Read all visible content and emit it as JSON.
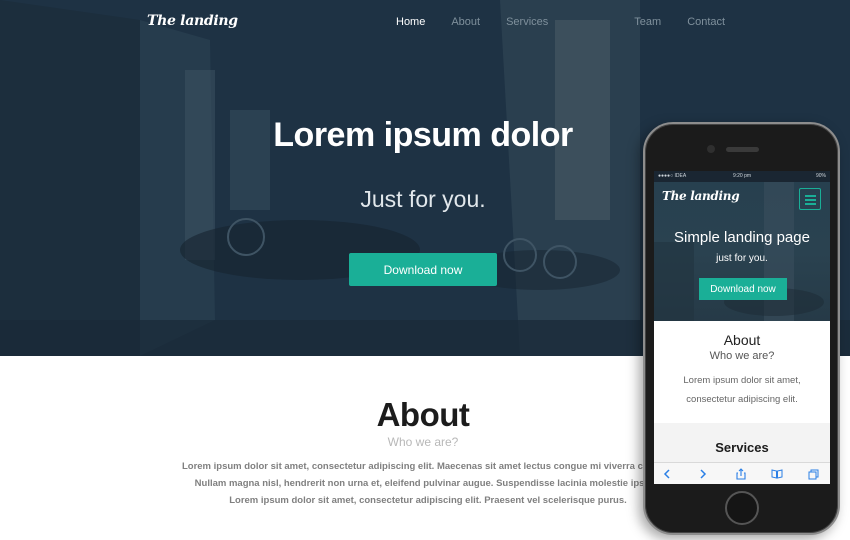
{
  "nav": {
    "logo": "The landing",
    "links": [
      "Home",
      "About",
      "Services",
      "Team",
      "Contact"
    ],
    "active": "Home"
  },
  "hero": {
    "title": "Lorem ipsum dolor",
    "subtitle": "Just for you.",
    "button": "Download now"
  },
  "about": {
    "title": "About",
    "subtitle": "Who we are?",
    "lines": [
      "Lorem ipsum dolor sit amet, consectetur adipiscing elit. Maecenas sit amet lectus congue mi viverra congue.",
      "Nullam magna nisl, hendrerit non urna et, eleifend pulvinar augue. Suspendisse lacinia molestie ipsum.",
      "Lorem ipsum dolor sit amet, consectetur adipiscing elit. Praesent vel scelerisque purus."
    ]
  },
  "mobile": {
    "status": {
      "carrier": "●●●●○ IDEA",
      "time": "9:20 pm",
      "battery": "90%"
    },
    "logo": "The landing",
    "hero_title": "Simple landing page",
    "hero_sub": "just for you.",
    "button": "Download now",
    "about_title": "About",
    "about_sub": "Who we are?",
    "about_lines": [
      "Lorem ipsum dolor sit amet,",
      "consectetur adipiscing elit."
    ],
    "services_title": "Services",
    "toolbar_icons": [
      "back-icon",
      "forward-icon",
      "share-icon",
      "bookmarks-icon",
      "tabs-icon"
    ]
  },
  "colors": {
    "accent": "#1aaf97",
    "hero_bg": "#1f3448",
    "ios_blue": "#2a7fe6"
  }
}
